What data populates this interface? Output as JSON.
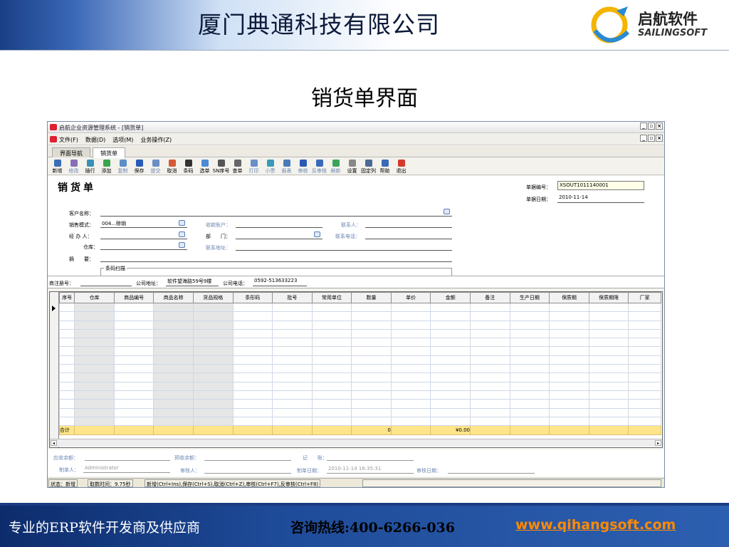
{
  "header": {
    "title": "厦门典通科技有限公司",
    "logo_cn": "启航软件",
    "logo_en": "SAILINGSOFT"
  },
  "slide_title": "销货单界面",
  "app": {
    "title": "启航企业资源管理系统 - [销货单]",
    "menu": [
      "文件(F)",
      "数据(D)",
      "选项(M)",
      "业务操作(Z)"
    ],
    "tabs": [
      "界面导航",
      "销货单"
    ],
    "toolbar": [
      {
        "label": "新增",
        "icon": "new-icon",
        "color": "#3a6fb7"
      },
      {
        "label": "修改",
        "icon": "edit-icon",
        "color": "#8a6fb7",
        "dim": true
      },
      {
        "label": "插行",
        "icon": "insert-row-icon",
        "color": "#3a8fb7"
      },
      {
        "label": "添加",
        "icon": "add-icon",
        "color": "#3aa54a"
      },
      {
        "label": "复制",
        "icon": "copy-icon",
        "color": "#5a8fc7",
        "dim": true
      },
      {
        "label": "保存",
        "icon": "save-icon",
        "color": "#2a5ab7"
      },
      {
        "label": "提交",
        "icon": "submit-icon",
        "color": "#6a8fc7",
        "dim": true
      },
      {
        "label": "取消",
        "icon": "cancel-icon",
        "color": "#d45a3a"
      },
      {
        "label": "条码",
        "icon": "barcode-icon",
        "color": "#333"
      },
      {
        "label": "选单",
        "icon": "select-order-icon",
        "color": "#4a8ad7"
      },
      {
        "label": "SN序号",
        "icon": "sn-icon",
        "color": "#555"
      },
      {
        "label": "查单",
        "icon": "search-order-icon",
        "color": "#666"
      },
      {
        "label": "打印",
        "icon": "print-icon",
        "color": "#6a8fc7",
        "dim": true
      },
      {
        "label": "小票",
        "icon": "receipt-icon",
        "color": "#3a9ab7",
        "dim": true
      },
      {
        "label": "报表",
        "icon": "report-icon",
        "color": "#4a7ab7",
        "dim": true
      },
      {
        "label": "审核",
        "icon": "approve-icon",
        "color": "#2a5ab7",
        "dim": true
      },
      {
        "label": "反审核",
        "icon": "unapprove-icon",
        "color": "#3a6ab7",
        "dim": true
      },
      {
        "label": "刷新",
        "icon": "refresh-icon",
        "color": "#3aa55a",
        "dim": true
      },
      {
        "label": "设置",
        "icon": "settings-icon",
        "color": "#888"
      },
      {
        "label": "固定列",
        "icon": "fixed-column-icon",
        "color": "#4a6a97"
      },
      {
        "label": "帮助",
        "icon": "help-icon",
        "color": "#3a6ab7"
      },
      {
        "label": "退出",
        "icon": "exit-icon",
        "color": "#d43a2a"
      }
    ],
    "form": {
      "title": "销货单",
      "doc_no_label": "单据编号：",
      "doc_no": "XSOUT1011140001",
      "doc_date_label": "单据日期：",
      "doc_date": "2010-11-14",
      "customer_label": "客户名称：",
      "sale_mode_label": "销售模式：",
      "sale_mode": "004...赊销",
      "operator_label": "经 办 人：",
      "warehouse_label": "仓库：",
      "summary_label": "摘　　要：",
      "account_label": "收款账户：",
      "dept_label": "部　　门：",
      "contact_label": "联系人：",
      "contact_phone_label": "联系电话：",
      "contact_addr_label": "联系地址：",
      "barcode_group": "条码扫描"
    },
    "info": {
      "reg_label": "商注册号：",
      "company_addr_label": "公司地址：",
      "company_addr": "软件望海路59号9楼",
      "company_phone_label": "公司电话：",
      "company_phone": "0592-513633223"
    },
    "grid": {
      "columns": [
        "序号",
        "仓库",
        "商品编号",
        "商品名称",
        "货品规格",
        "条形码",
        "批号",
        "常用单位",
        "数量",
        "单价",
        "金额",
        "备注",
        "生产日期",
        "保质期",
        "保质期限",
        "厂家"
      ],
      "total_label": "合计",
      "total_qty": "0",
      "total_amount": "¥0.00"
    },
    "footer": {
      "receivable_label": "应收余额：",
      "prepaid_label": "预收余额：",
      "bookkeep_label": "记　　账：",
      "maker_label": "制单人：",
      "maker": "Administrator",
      "auditor_label": "审核人：",
      "make_date_label": "制单日期：",
      "make_date": "2010-11-14 16:35:31",
      "audit_date_label": "审核日期："
    },
    "status": {
      "state": "状态：新增",
      "time": "取数时间：9.75秒",
      "hints": "新增(Ctrl+Ins),保存(Ctrl+S),取消(Ctrl+Z),审核(Ctrl+F7),反审核(Ctrl+F8)"
    }
  },
  "bottom": {
    "tagline": "专业的ERP软件开发商及供应商",
    "hotline": "咨询热线:400-6266-036",
    "website": "www.qihangsoft.com"
  }
}
